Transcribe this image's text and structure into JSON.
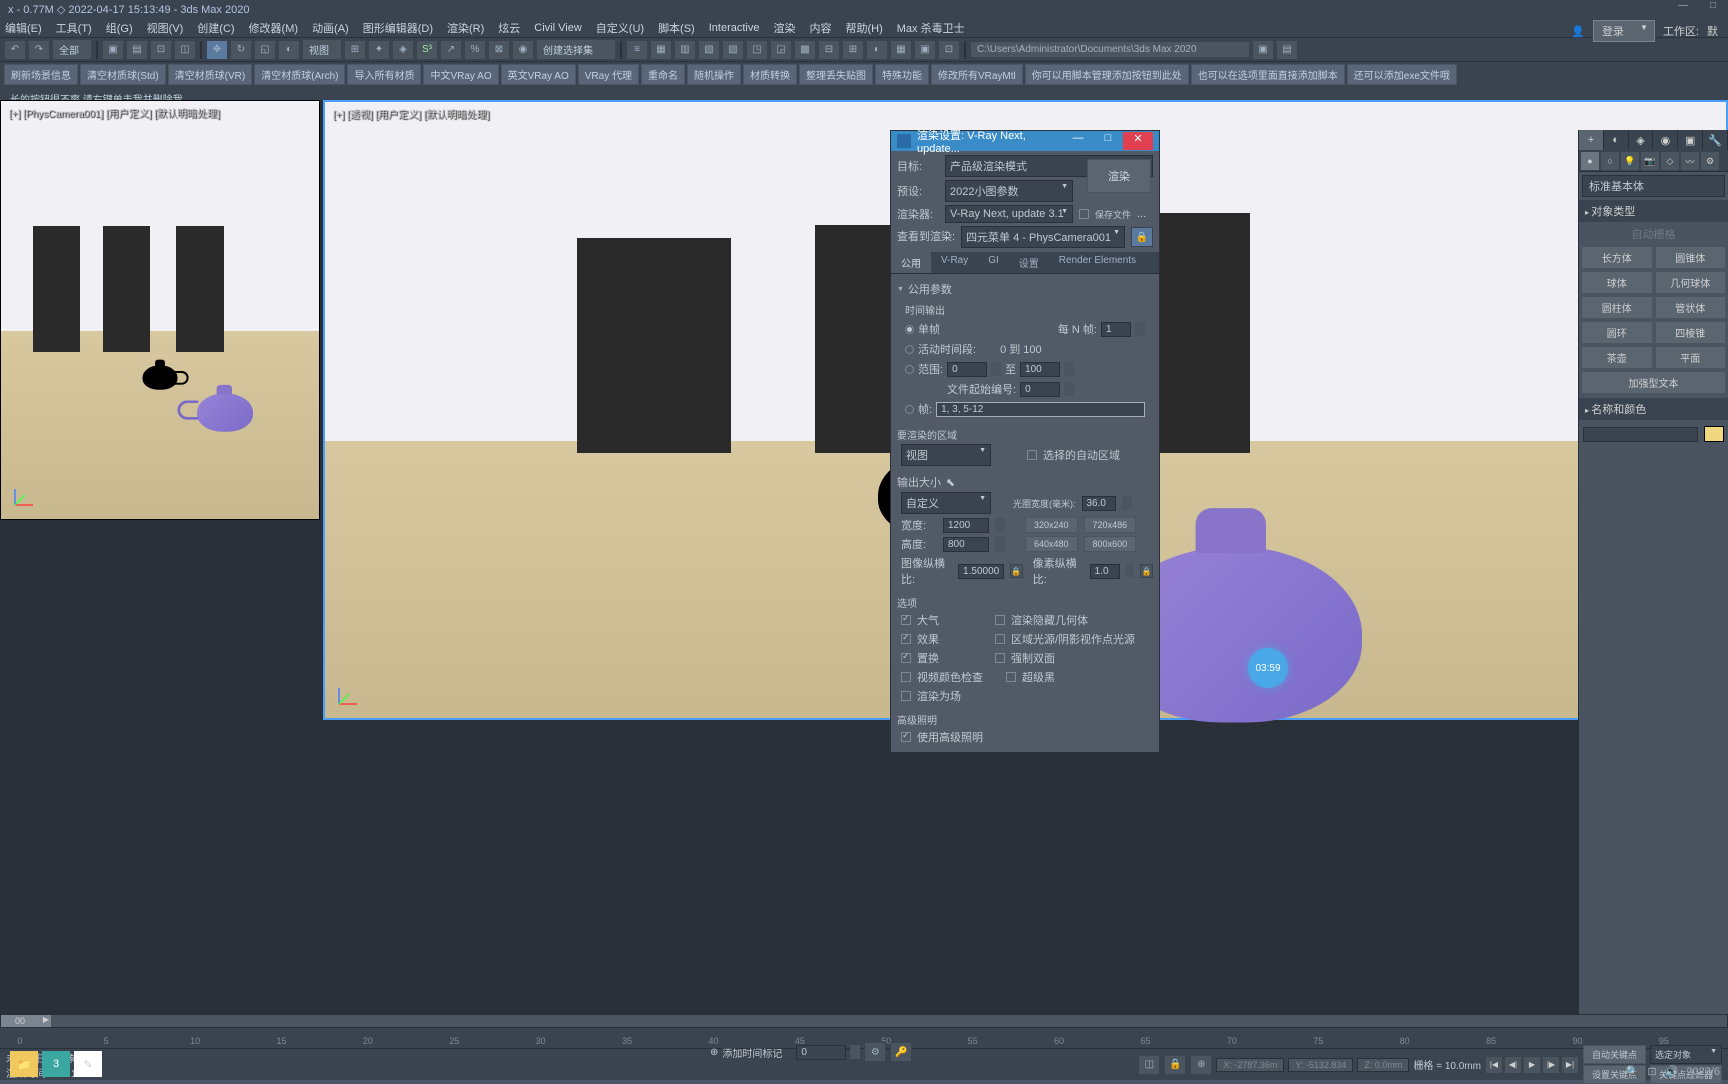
{
  "title_bar": "x - 0.77M ◇ 2022-04-17 15:13:49 - 3ds Max 2020",
  "menu": [
    "编辑(E)",
    "工具(T)",
    "组(G)",
    "视图(V)",
    "创建(C)",
    "修改器(M)",
    "动画(A)",
    "图形编辑器(D)",
    "渲染(R)",
    "炫云",
    "Civil View",
    "自定义(U)",
    "脚本(S)",
    "Interactive",
    "渲染",
    "内容",
    "帮助(H)",
    "Max 杀毒卫士"
  ],
  "login": {
    "label": "登录"
  },
  "workspace": {
    "label": "工作区:",
    "value": "默"
  },
  "toolbar": {
    "dropdown1": "全部",
    "dropdown2": "视图",
    "dropdown3": "创建选择集",
    "path": "C:\\Users\\Administrator\\Documents\\3ds Max 2020"
  },
  "scripts": [
    "刷新场景信息",
    "清空材质球(Std)",
    "清空材质球(VR)",
    "清空材质球(Arch)",
    "导入所有材质",
    "中文VRay AO",
    "英文VRay AO",
    "VRay 代理",
    "重命名",
    "随机操作",
    "材质转换",
    "整理丢失贴图",
    "特殊功能",
    "修改所有VRayMtl",
    "你可以用脚本管理添加按钮到此处",
    "也可以在选项里面直接添加脚本",
    "还可以添加exe文件哦"
  ],
  "script_msg": "长的按钮很不爽,请右键单击我并删除我",
  "viewport_left_label": "[+] [PhysCamera001] [用户定义] [默认明暗处理]",
  "viewport_right_label": "[+] [透视] [用户定义] [默认明暗处理]",
  "render_dialog": {
    "title": "渲染设置: V-Ray Next, update...",
    "target_label": "目标:",
    "target_value": "产品级渲染模式",
    "preset_label": "预设:",
    "preset_value": "2022小图参数",
    "renderer_label": "渲染器:",
    "renderer_value": "V-Ray Next, update 3.1",
    "save_file": "保存文件",
    "view_label": "查看到渲染:",
    "view_value": "四元菜单 4 - PhysCamera001",
    "render_btn": "渲染",
    "tabs": [
      "公用",
      "V-Ray",
      "GI",
      "设置",
      "Render Elements"
    ],
    "section_common": "公用参数",
    "time_output": "时间输出",
    "single_frame": "单帧",
    "every_n": "每 N 帧:",
    "every_n_val": "1",
    "active_range": "活动时间段:",
    "active_range_val": "0 到 100",
    "range": "范围:",
    "range_from": "0",
    "range_to_label": "至",
    "range_to": "100",
    "file_num": "文件起始编号:",
    "file_num_val": "0",
    "frames": "帧:",
    "frames_val": "1, 3, 5-12",
    "area_label": "要渲染的区域",
    "area_value": "视图",
    "auto_area": "选择的自动区域",
    "output_size": "输出大小",
    "output_custom": "自定义",
    "aperture_label": "光圈宽度(毫米):",
    "aperture_val": "36.0",
    "width_label": "宽度:",
    "width_val": "1200",
    "height_label": "高度:",
    "height_val": "800",
    "preset_320": "320x240",
    "preset_720": "720x486",
    "preset_640": "640x480",
    "preset_800": "800x600",
    "aspect_label": "图像纵横比:",
    "aspect_val": "1.50000",
    "pixel_aspect_label": "像素纵横比:",
    "pixel_aspect_val": "1.0",
    "options": "选项",
    "opt_atmosphere": "大气",
    "opt_hidden": "渲染隐藏几何体",
    "opt_effects": "效果",
    "opt_area_light": "区域光源/阴影视作点光源",
    "opt_displace": "置换",
    "opt_force2": "强制双面",
    "opt_video": "视频颜色检查",
    "opt_super": "超级黑",
    "opt_field": "渲染为场",
    "adv_light": "高级照明",
    "use_adv_light": "使用高级照明"
  },
  "right_panel": {
    "dropdown": "标准基本体",
    "section_type": "对象类型",
    "auto_grid": "自动栅格",
    "objects": [
      "长方体",
      "圆锥体",
      "球体",
      "几何球体",
      "圆柱体",
      "管状体",
      "圆环",
      "四棱锥",
      "茶壶",
      "平面",
      "加强型文本"
    ],
    "section_name": "名称和颜色"
  },
  "timeline": {
    "marks": [
      "0",
      "5",
      "10",
      "15",
      "20",
      "25",
      "30",
      "35",
      "40",
      "45",
      "50",
      "55",
      "60",
      "65",
      "70",
      "75",
      "80",
      "85",
      "90",
      "95"
    ],
    "slider_val": "00"
  },
  "status": {
    "no_select": "未选定任何对象",
    "render_time": "渲染时间 0:04:11",
    "x": "X: -2787.36m",
    "y": "Y: -5132.834",
    "z": "Z: 0.0mm",
    "grid": "栅格 = 10.0mm",
    "add_time_marker": "添加时间标记",
    "auto_key": "自动关键点",
    "selected": "选定对象",
    "set_key": "设置关键点",
    "key_filter": "关键点过滤器",
    "frame": "0",
    "date": "2022/6"
  },
  "badge": "03:59"
}
